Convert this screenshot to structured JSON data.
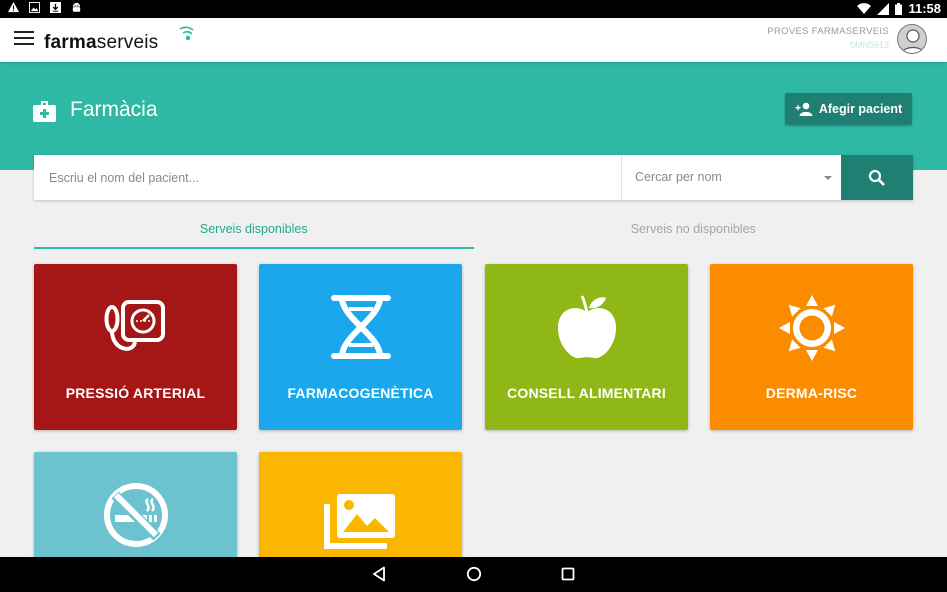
{
  "status_bar": {
    "time": "11:58"
  },
  "app_bar": {
    "logo_bold": "farma",
    "logo_light": "serveis",
    "user_name": "PROVES FARMASERVEIS",
    "user_sub": "0MN5613"
  },
  "header": {
    "title": "Farmàcia",
    "add_patient_label": "Afegir pacient"
  },
  "search": {
    "placeholder": "Escriu el nom del pacient...",
    "value": "",
    "filter_selected": "Cercar per nom"
  },
  "tabs": [
    {
      "label": "Serveis disponibles",
      "active": true
    },
    {
      "label": "Serveis no disponibles",
      "active": false
    }
  ],
  "services": [
    {
      "label": "PRESSIÓ ARTERIAL",
      "color": "#a51616",
      "icon": "blood-pressure-icon"
    },
    {
      "label": "FARMACOGENÈTICA",
      "color": "#1aa7ec",
      "icon": "dna-icon"
    },
    {
      "label": "CONSELL ALIMENTARI",
      "color": "#8fb817",
      "icon": "apple-icon"
    },
    {
      "label": "DERMA-RISC",
      "color": "#fb8c00",
      "icon": "sun-icon"
    },
    {
      "label": "",
      "color": "#6cc3cf",
      "icon": "no-smoking-icon"
    },
    {
      "label": "",
      "color": "#fbb700",
      "icon": "images-icon"
    }
  ],
  "colors": {
    "accent": "#2fb8a3",
    "accent_dark": "#1f7f72"
  }
}
